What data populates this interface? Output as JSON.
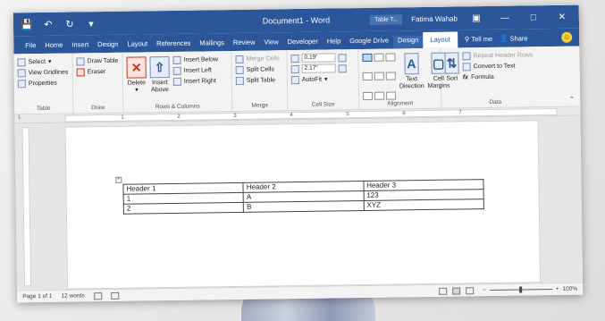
{
  "title": {
    "document": "Document1 - Word",
    "context_tag": "Table T...",
    "user": "Fatima Wahab"
  },
  "tabs": [
    "File",
    "Home",
    "Insert",
    "Design",
    "Layout",
    "References",
    "Mailings",
    "Review",
    "View",
    "Developer",
    "Help",
    "Google Drive"
  ],
  "context_tabs": {
    "design": "Design",
    "layout": "Layout"
  },
  "tell_me": "Tell me",
  "share": "Share",
  "ribbon": {
    "table": {
      "select": "Select",
      "view_gridlines": "View Gridlines",
      "properties": "Properties",
      "label": "Table"
    },
    "draw": {
      "draw_table": "Draw Table",
      "eraser": "Eraser",
      "label": "Draw"
    },
    "rows_cols": {
      "delete": "Delete",
      "insert_above_1": "Insert",
      "insert_above_2": "Above",
      "insert_below": "Insert Below",
      "insert_left": "Insert Left",
      "insert_right": "Insert Right",
      "label": "Rows & Columns"
    },
    "merge": {
      "merge_cells": "Merge Cells",
      "split_cells": "Split Cells",
      "split_table": "Split Table",
      "label": "Merge"
    },
    "cell_size": {
      "height": "0.19\"",
      "width": "2.17\"",
      "autofit": "AutoFit",
      "label": "Cell Size"
    },
    "alignment": {
      "text_direction_1": "Text",
      "text_direction_2": "Direction",
      "cell_margins_1": "Cell",
      "cell_margins_2": "Margins",
      "label": "Alignment"
    },
    "data": {
      "sort": "Sort",
      "repeat_header": "Repeat Header Rows",
      "convert": "Convert to Text",
      "formula": "Formula",
      "label": "Data"
    }
  },
  "ruler_numbers": [
    "1",
    "2",
    "3",
    "4",
    "5",
    "6",
    "7"
  ],
  "table_rows": [
    [
      "Header 1",
      "Header 2",
      "Header 3"
    ],
    [
      "1",
      "A",
      "123"
    ],
    [
      "2",
      "B",
      "XYZ"
    ]
  ],
  "status": {
    "page": "Page 1 of 1",
    "words": "12 words",
    "zoom": "100%"
  }
}
